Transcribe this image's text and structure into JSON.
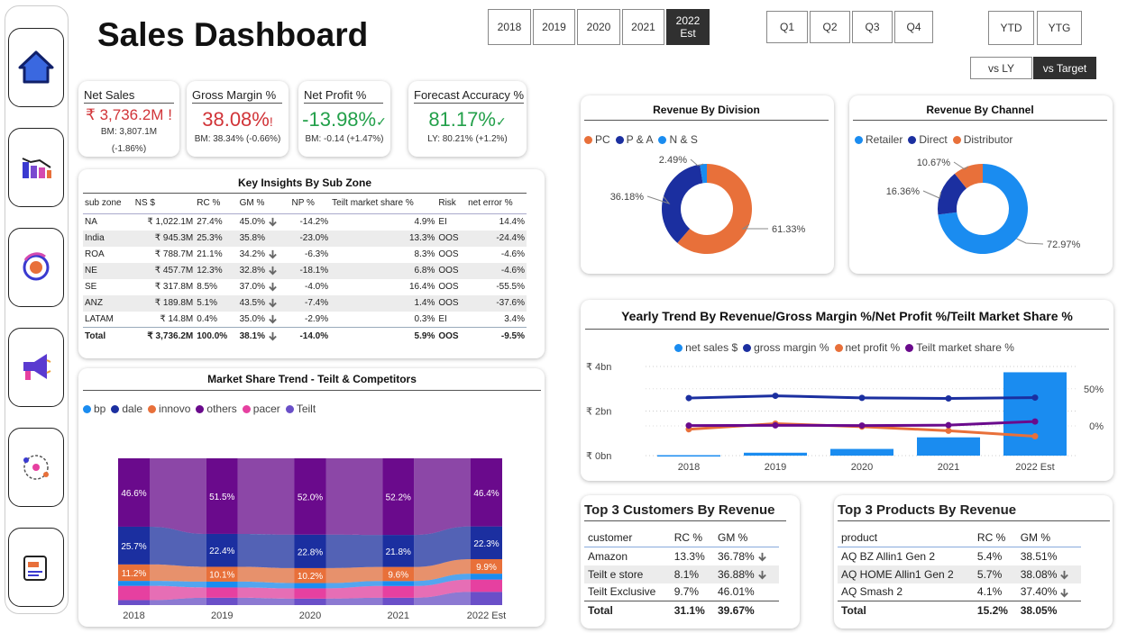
{
  "header": {
    "title": "Sales Dashboard"
  },
  "filters": {
    "years": [
      "2018",
      "2019",
      "2020",
      "2021",
      "2022 Est"
    ],
    "selected_year": "2022 Est",
    "quarters": [
      "Q1",
      "Q2",
      "Q3",
      "Q4"
    ],
    "period": [
      "YTD",
      "YTG"
    ],
    "compare": [
      "vs LY",
      "vs Target"
    ],
    "selected_compare": "vs Target"
  },
  "sidebar": {
    "items": [
      {
        "icon": "home-icon"
      },
      {
        "icon": "bar-chart-icon"
      },
      {
        "icon": "finance-icon"
      },
      {
        "icon": "megaphone-icon"
      },
      {
        "icon": "supply-chain-icon"
      },
      {
        "icon": "report-icon"
      }
    ]
  },
  "kpis": {
    "net_sales": {
      "title": "Net Sales",
      "value": "₹ 3,736.2M",
      "flag": "!",
      "line1": "BM: 3,807.1M",
      "line2": "(-1.86%)",
      "color": "#d13438"
    },
    "gross_margin": {
      "title": "Gross Margin %",
      "value": "38.08%",
      "flag": "!",
      "line1": "BM: 38.34% (-0.66%)",
      "color": "#d13438"
    },
    "net_profit": {
      "title": "Net Profit %",
      "value": "-13.98%",
      "flag": "✓",
      "line1": "BM: -0.14 (+1.47%)",
      "color": "#23a04a"
    },
    "forecast": {
      "title": "Forecast Accuracy %",
      "value": "81.17%",
      "flag": "✓",
      "line1": "LY: 80.21% (+1.2%)",
      "color": "#23a04a"
    }
  },
  "insights": {
    "title": "Key Insights By Sub Zone",
    "columns": [
      "sub zone",
      "NS $",
      "RC %",
      "GM %",
      "NP %",
      "Teilt market share %",
      "Risk",
      "net error %"
    ],
    "rows": [
      {
        "zone": "NA",
        "ns": "₹ 1,022.1M",
        "rc": "27.4%",
        "gm": "45.0%",
        "down": true,
        "np": "-14.2%",
        "ms": "4.9%",
        "risk": "EI",
        "err": "14.4%"
      },
      {
        "zone": "India",
        "ns": "₹ 945.3M",
        "rc": "25.3%",
        "gm": "35.8%",
        "down": false,
        "np": "-23.0%",
        "ms": "13.3%",
        "risk": "OOS",
        "err": "-24.4%"
      },
      {
        "zone": "ROA",
        "ns": "₹ 788.7M",
        "rc": "21.1%",
        "gm": "34.2%",
        "down": true,
        "np": "-6.3%",
        "ms": "8.3%",
        "risk": "OOS",
        "err": "-4.6%"
      },
      {
        "zone": "NE",
        "ns": "₹ 457.7M",
        "rc": "12.3%",
        "gm": "32.8%",
        "down": true,
        "np": "-18.1%",
        "ms": "6.8%",
        "risk": "OOS",
        "err": "-4.6%"
      },
      {
        "zone": "SE",
        "ns": "₹ 317.8M",
        "rc": "8.5%",
        "gm": "37.0%",
        "down": true,
        "np": "-4.0%",
        "ms": "16.4%",
        "risk": "OOS",
        "err": "-55.5%"
      },
      {
        "zone": "ANZ",
        "ns": "₹ 189.8M",
        "rc": "5.1%",
        "gm": "43.5%",
        "down": true,
        "np": "-7.4%",
        "ms": "1.4%",
        "risk": "OOS",
        "err": "-37.6%"
      },
      {
        "zone": "LATAM",
        "ns": "₹ 14.8M",
        "rc": "0.4%",
        "gm": "35.0%",
        "down": true,
        "np": "-2.9%",
        "ms": "0.3%",
        "risk": "EI",
        "err": "3.4%"
      }
    ],
    "total": {
      "zone": "Total",
      "ns": "₹ 3,736.2M",
      "rc": "100.0%",
      "gm": "38.1%",
      "down": true,
      "np": "-14.0%",
      "ms": "5.9%",
      "risk": "OOS",
      "err": "-9.5%"
    }
  },
  "customers": {
    "title": "Top 3 Customers By Revenue",
    "columns": [
      "customer",
      "RC %",
      "GM %"
    ],
    "rows": [
      {
        "name": "Amazon",
        "rc": "13.3%",
        "gm": "36.78%",
        "down": true
      },
      {
        "name": "Teilt e store",
        "rc": "8.1%",
        "gm": "36.88%",
        "down": true
      },
      {
        "name": "Teilt Exclusive",
        "rc": "9.7%",
        "gm": "46.01%",
        "down": false
      }
    ],
    "total": {
      "name": "Total",
      "rc": "31.1%",
      "gm": "39.67%"
    }
  },
  "products": {
    "title": "Top 3 Products By Revenue",
    "columns": [
      "product",
      "RC %",
      "GM %"
    ],
    "rows": [
      {
        "name": "AQ BZ Allin1 Gen 2",
        "rc": "5.4%",
        "gm": "38.51%",
        "down": false
      },
      {
        "name": "AQ HOME Allin1 Gen 2",
        "rc": "5.7%",
        "gm": "38.08%",
        "down": true
      },
      {
        "name": "AQ Smash 2",
        "rc": "4.1%",
        "gm": "37.40%",
        "down": true
      }
    ],
    "total": {
      "name": "Total",
      "rc": "15.2%",
      "gm": "38.05%"
    }
  },
  "chart_data": [
    {
      "id": "division",
      "type": "pie",
      "title": "Revenue By Division",
      "categories": [
        "PC",
        "P & A",
        "N & S"
      ],
      "values": [
        61.33,
        36.18,
        2.49
      ],
      "labels": [
        "61.33%",
        "36.18%",
        "2.49%"
      ],
      "colors": [
        "#e8703a",
        "#1b2fa0",
        "#1a8cf0"
      ],
      "legend": "top-left"
    },
    {
      "id": "channel",
      "type": "pie",
      "title": "Revenue By Channel",
      "categories": [
        "Retailer",
        "Direct",
        "Distributor"
      ],
      "values": [
        72.97,
        16.36,
        10.67
      ],
      "labels": [
        "72.97%",
        "16.36%",
        "10.67%"
      ],
      "colors": [
        "#1a8cf0",
        "#1b2fa0",
        "#e8703a"
      ],
      "legend": "top-left"
    },
    {
      "id": "yearly",
      "type": "bar",
      "title": "Yearly Trend By Revenue/Gross Margin %/Net Profit %/Teilt Market Share %",
      "categories": [
        "2018",
        "2019",
        "2020",
        "2021",
        "2022 Est"
      ],
      "series": [
        {
          "name": "net sales $",
          "kind": "bar",
          "axis": "left",
          "color": "#1a8cf0",
          "values": [
            0.02,
            0.13,
            0.3,
            0.82,
            3.74
          ]
        },
        {
          "name": "gross margin %",
          "kind": "line",
          "axis": "right",
          "color": "#1b2fa0",
          "values": [
            37.5,
            40.5,
            37.7,
            37.0,
            38.1
          ]
        },
        {
          "name": "net profit %",
          "kind": "line",
          "axis": "right",
          "color": "#e8703a",
          "values": [
            -4.5,
            3.0,
            -1.0,
            -6.5,
            -14.0
          ]
        },
        {
          "name": "Teilt market share %",
          "kind": "line",
          "axis": "right",
          "color": "#6a0a8c",
          "values": [
            0.5,
            0.8,
            0.5,
            1.0,
            5.9
          ]
        }
      ],
      "yticks_left": [
        "₹ 0bn",
        "₹ 2bn",
        "₹ 4bn"
      ],
      "ylim_left": [
        0,
        4
      ],
      "yticks_right": [
        "0%",
        "50%"
      ],
      "ylim_right": [
        -40,
        80
      ],
      "legend": "top-center"
    },
    {
      "id": "market_share",
      "type": "area",
      "title": "Market Share Trend - Teilt & Competitors",
      "categories": [
        "2018",
        "2019",
        "2020",
        "2021",
        "2022 Est"
      ],
      "series": [
        {
          "name": "bp",
          "color": "#1a8cf0",
          "values": [
            3.4,
            4.0,
            3.6,
            3.4,
            4.0
          ]
        },
        {
          "name": "dale",
          "color": "#1b2fa0",
          "values": [
            25.7,
            22.4,
            22.8,
            21.8,
            22.3
          ]
        },
        {
          "name": "innovo",
          "color": "#e8703a",
          "values": [
            11.2,
            10.1,
            10.2,
            9.6,
            9.9
          ]
        },
        {
          "name": "others",
          "color": "#6a0a8c",
          "values": [
            46.6,
            51.5,
            52.0,
            52.2,
            46.4
          ]
        },
        {
          "name": "pacer",
          "color": "#e640a0",
          "values": [
            9.7,
            7.0,
            7.0,
            8.0,
            8.4
          ]
        },
        {
          "name": "Teilt",
          "color": "#6a4fc8",
          "values": [
            3.4,
            5.0,
            4.4,
            5.0,
            9.0
          ]
        }
      ],
      "labeled": [
        "dale",
        "innovo",
        "others"
      ],
      "stack_order": [
        "Teilt",
        "pacer",
        "bp",
        "innovo",
        "dale",
        "others"
      ],
      "legend": "top-left"
    }
  ]
}
